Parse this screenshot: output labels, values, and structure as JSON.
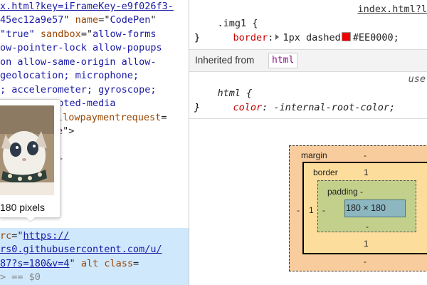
{
  "elements": {
    "lines": [
      {
        "parts": [
          {
            "t": "x.html?key=iFrameKey-e9f026f3-",
            "c": "lk"
          }
        ]
      },
      {
        "parts": [
          {
            "t": "45ec12a9e57",
            "c": "av"
          },
          {
            "t": "\" ",
            "c": "tx"
          },
          {
            "t": "name",
            "c": "an"
          },
          {
            "t": "=\"",
            "c": "tx"
          },
          {
            "t": "CodePen",
            "c": "av"
          },
          {
            "t": "\"",
            "c": "tx"
          }
        ]
      },
      {
        "parts": [
          {
            "t": "\"true\" ",
            "c": "av"
          },
          {
            "t": "sandbox",
            "c": "an"
          },
          {
            "t": "=\"",
            "c": "tx"
          },
          {
            "t": "allow-forms",
            "c": "av"
          }
        ]
      },
      {
        "parts": [
          {
            "t": "ow-pointer-lock allow-popups",
            "c": "av"
          }
        ]
      },
      {
        "parts": [
          {
            "t": "on allow-same-origin allow-",
            "c": "av"
          }
        ]
      },
      {
        "parts": [
          {
            "t": "geolocation; microphone;",
            "c": "av"
          }
        ]
      },
      {
        "parts": [
          {
            "t": "; accelerometer; gyroscope;",
            "c": "av"
          }
        ]
      },
      {
        "parts": [
          {
            "t": "sor; encrypted-media",
            "c": "av"
          }
        ]
      },
      {
        "parts": [
          {
            "t": "llowpaymentrequest",
            "c": "an"
          },
          {
            "t": "=",
            "c": "tx"
          }
        ]
      },
      {
        "parts": [
          {
            "t": "e",
            "c": "tg"
          },
          {
            "t": "\">",
            "c": "tx"
          }
        ]
      },
      {
        "parts": [
          {
            "t": "",
            "c": "tx"
          }
        ]
      },
      {
        "parts": [
          {
            "t": ">",
            "c": "gr"
          }
        ]
      },
      {
        "parts": [
          {
            "t": "",
            "c": "tx"
          }
        ]
      },
      {
        "parts": [
          {
            "t": "",
            "c": "tx"
          }
        ]
      },
      {
        "parts": [
          {
            "t": "  main\"",
            "c": "av"
          }
        ]
      },
      {
        "parts": [
          {
            "t": "rc",
            "c": "an"
          },
          {
            "t": "=\"",
            "c": "tx"
          },
          {
            "t": "https://",
            "c": "lk"
          }
        ]
      },
      {
        "parts": [
          {
            "t": "rs0.githubusercontent.com/u/",
            "c": "lk"
          }
        ]
      },
      {
        "parts": [
          {
            "t": "87?s=180&v=4",
            "c": "lk"
          },
          {
            "t": "\" ",
            "c": "tx"
          },
          {
            "t": "alt class",
            "c": "an"
          },
          {
            "t": "=",
            "c": "tx"
          }
        ]
      },
      {
        "parts": [
          {
            "t": "> == $0",
            "c": "gr"
          }
        ]
      }
    ]
  },
  "tooltip": {
    "caption": "180 pixels"
  },
  "styles": {
    "rule1": {
      "selector": ".img1 {",
      "source": "index.html?l",
      "property": "border",
      "value": "1px dashed",
      "color_value": "#EE0000",
      "swatch_color": "#EE0000",
      "close": "}"
    },
    "inherited": {
      "label": "Inherited from",
      "tag": "html"
    },
    "rule2": {
      "selector": "html {",
      "source": "use",
      "property": "color",
      "value": "-internal-root-color;",
      "close": "}"
    }
  },
  "box_model": {
    "margin_label": "margin",
    "margin_top": "-",
    "margin_left": "-",
    "margin_bottom": "-",
    "border_label": "border",
    "border_top": "1",
    "border_left": "1",
    "border_bottom": "1",
    "padding_label": "padding -",
    "padding_left": "-",
    "padding_bottom": "-",
    "content": "180 × 180"
  }
}
